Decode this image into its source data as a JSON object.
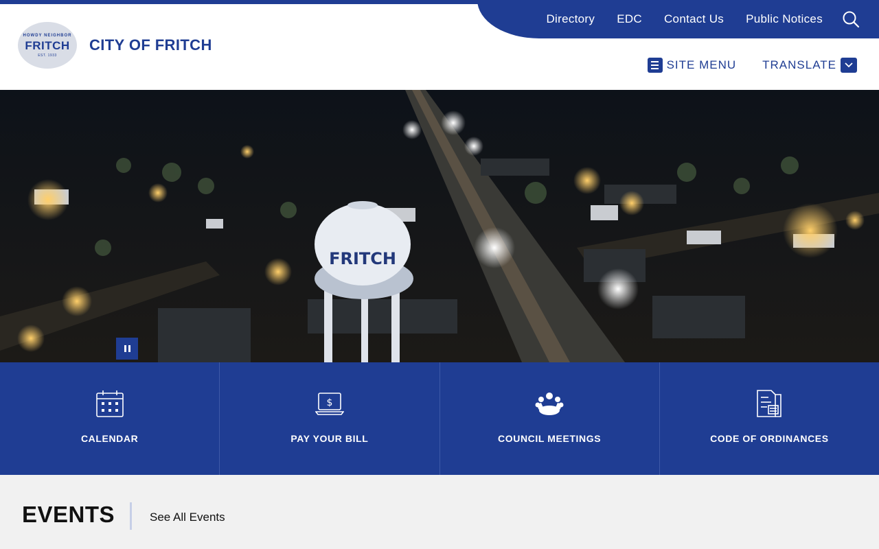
{
  "site": {
    "title": "CITY OF FRITCH",
    "seal_arc": "HOWDY NEIGHBOR",
    "seal_word": "FRITCH",
    "seal_since": "EST. 1933"
  },
  "utility_nav": [
    "Directory",
    "EDC",
    "Contact Us",
    "Public Notices"
  ],
  "sub_nav": {
    "site_menu": "SITE MENU",
    "translate": "TRANSLATE"
  },
  "hero": {
    "tower_text": "FRITCH"
  },
  "quick_links": [
    {
      "label": "CALENDAR",
      "icon": "calendar-icon"
    },
    {
      "label": "PAY YOUR BILL",
      "icon": "laptop-dollar-icon"
    },
    {
      "label": "COUNCIL MEETINGS",
      "icon": "people-group-icon"
    },
    {
      "label": "CODE OF ORDINANCES",
      "icon": "document-icon"
    }
  ],
  "events": {
    "heading": "EVENTS",
    "see_all": "See All Events"
  },
  "colors": {
    "brand": "#1f3d93",
    "background": "#f1f1f1"
  }
}
